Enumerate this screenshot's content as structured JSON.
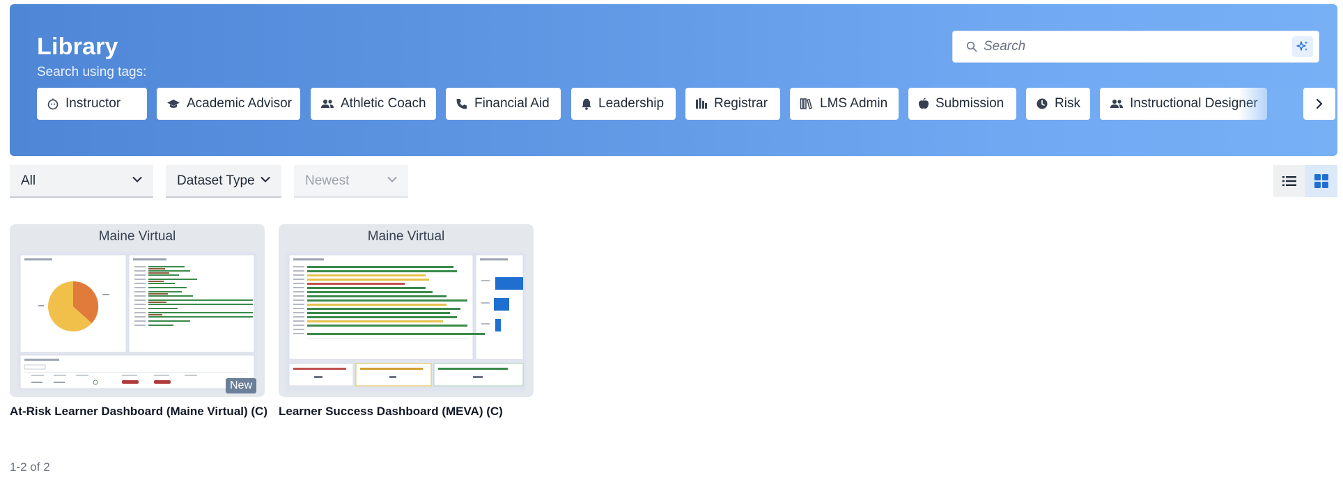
{
  "header": {
    "title": "Library",
    "subtitle": "Search using tags:"
  },
  "search": {
    "placeholder": "Search"
  },
  "tags": [
    {
      "label": "Instructor",
      "icon": "instructor-icon"
    },
    {
      "label": "Academic Advisor",
      "icon": "graduation-cap-icon"
    },
    {
      "label": "Athletic Coach",
      "icon": "users-icon"
    },
    {
      "label": "Financial Aid",
      "icon": "phone-icon"
    },
    {
      "label": "Leadership",
      "icon": "bell-icon"
    },
    {
      "label": "Registrar",
      "icon": "building-icon"
    },
    {
      "label": "LMS Admin",
      "icon": "library-icon"
    },
    {
      "label": "Submission",
      "icon": "apple-icon"
    },
    {
      "label": "Risk",
      "icon": "clock-icon"
    },
    {
      "label": "Instructional Designer",
      "icon": "users-icon"
    }
  ],
  "filters": {
    "all": "All",
    "dataset_type": "Dataset Type",
    "sort": "Newest"
  },
  "cards": [
    {
      "org": "Maine Virtual",
      "title": "At-Risk Learner Dashboard (Maine Virtual) (C)",
      "badge": "New"
    },
    {
      "org": "Maine Virtual",
      "title": "Learner Success Dashboard (MEVA) (C)",
      "badge": ""
    }
  ],
  "pagination": {
    "text": "1-2 of 2"
  },
  "colors": {
    "banner_start": "#4f86d6",
    "banner_end": "#78b0f6",
    "accent": "#1f6fd1",
    "bar_green": "#3a8a4a",
    "bar_yellow": "#e6c04a",
    "bar_red": "#c0504d"
  }
}
